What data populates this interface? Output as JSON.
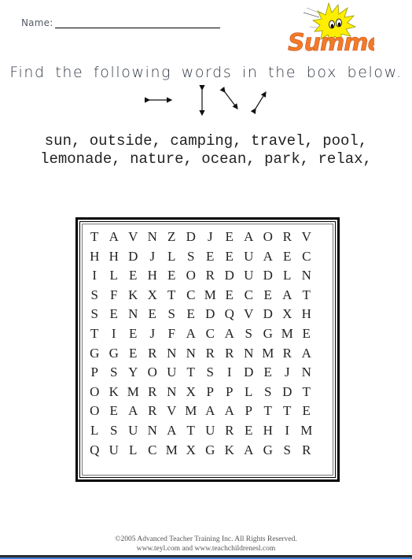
{
  "header": {
    "name_label": "Name:",
    "logo_text": "Summer",
    "logo_icon": "sun-icon"
  },
  "instructions": {
    "text": "Find the following words in the box below.",
    "direction_icons": [
      "horizontal-arrow-icon",
      "vertical-arrow-icon",
      "diagonal-down-arrow-icon",
      "diagonal-up-arrow-icon"
    ]
  },
  "word_list": {
    "line1": "sun, outside, camping, travel, pool,",
    "line2": "lemonade, nature, ocean, park, relax,",
    "words": [
      "sun",
      "outside",
      "camping",
      "travel",
      "pool",
      "lemonade",
      "nature",
      "ocean",
      "park",
      "relax"
    ]
  },
  "grid": {
    "rows": [
      [
        "T",
        "A",
        "V",
        "N",
        "Z",
        "D",
        "J",
        "E",
        "A",
        "O",
        "R",
        "V"
      ],
      [
        "H",
        "H",
        "D",
        "J",
        "L",
        "S",
        "E",
        "E",
        "U",
        "A",
        "E",
        "C"
      ],
      [
        "I",
        "L",
        "E",
        "H",
        "E",
        "O",
        "R",
        "D",
        "U",
        "D",
        "L",
        "N"
      ],
      [
        "S",
        "F",
        "K",
        "X",
        "T",
        "C",
        "M",
        "E",
        "C",
        "E",
        "A",
        "T"
      ],
      [
        "S",
        "E",
        "N",
        "E",
        "S",
        "E",
        "D",
        "Q",
        "V",
        "D",
        "X",
        "H"
      ],
      [
        "T",
        "I",
        "E",
        "J",
        "F",
        "A",
        "C",
        "A",
        "S",
        "G",
        "M",
        "E"
      ],
      [
        "G",
        "G",
        "E",
        "R",
        "N",
        "N",
        "R",
        "R",
        "N",
        "M",
        "R",
        "A"
      ],
      [
        "P",
        "S",
        "Y",
        "O",
        "U",
        "T",
        "S",
        "I",
        "D",
        "E",
        "J",
        "N"
      ],
      [
        "O",
        "K",
        "M",
        "R",
        "N",
        "X",
        "P",
        "P",
        "L",
        "S",
        "D",
        "T"
      ],
      [
        "O",
        "E",
        "A",
        "R",
        "V",
        "M",
        "A",
        "A",
        "P",
        "T",
        "T",
        "E"
      ],
      [
        "L",
        "S",
        "U",
        "N",
        "A",
        "T",
        "U",
        "R",
        "E",
        "H",
        "I",
        "M"
      ],
      [
        "Q",
        "U",
        "L",
        "C",
        "M",
        "X",
        "G",
        "K",
        "A",
        "G",
        "S",
        "R"
      ]
    ]
  },
  "footer": {
    "copyright": "©2005 Advanced Teacher Training Inc. All Rights Reserved.",
    "links": "www.teyl.com and www.teachchildrenesl.com"
  },
  "colors": {
    "logo_orange": "#f47a28",
    "sun_yellow": "#ffee00",
    "text_gray": "#333a45",
    "bottom_bar_blue": "#3a7fd5"
  }
}
